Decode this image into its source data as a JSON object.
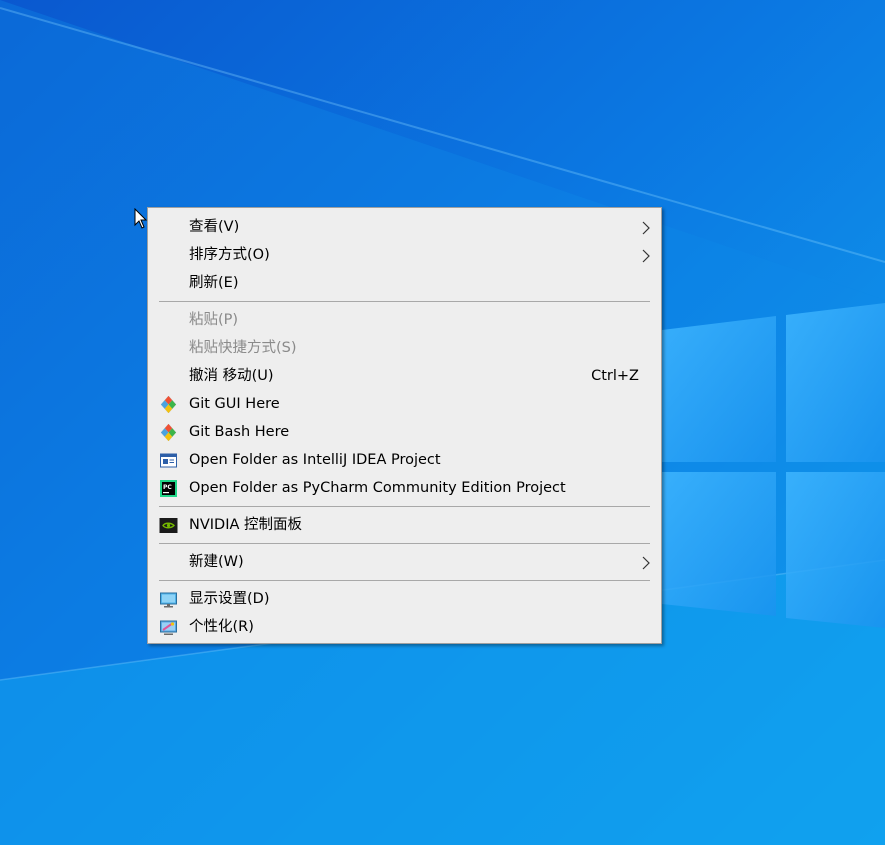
{
  "context_menu": {
    "items": [
      {
        "label": "查看(V)",
        "has_submenu": true
      },
      {
        "label": "排序方式(O)",
        "has_submenu": true
      },
      {
        "label": "刷新(E)"
      },
      {
        "label": "粘贴(P)",
        "disabled": true
      },
      {
        "label": "粘贴快捷方式(S)",
        "disabled": true
      },
      {
        "label": "撤消 移动(U)",
        "shortcut": "Ctrl+Z"
      },
      {
        "label": "Git GUI Here",
        "icon": "git-gui-icon"
      },
      {
        "label": "Git Bash Here",
        "icon": "git-bash-icon"
      },
      {
        "label": "Open Folder as IntelliJ IDEA Project",
        "icon": "intellij-idea-icon"
      },
      {
        "label": "Open Folder as PyCharm Community Edition Project",
        "icon": "pycharm-icon"
      },
      {
        "label": "NVIDIA 控制面板",
        "icon": "nvidia-icon"
      },
      {
        "label": "新建(W)",
        "has_submenu": true
      },
      {
        "label": "显示设置(D)",
        "icon": "display-settings-icon"
      },
      {
        "label": "个性化(R)",
        "icon": "personalize-icon"
      }
    ]
  },
  "colors": {
    "menu_background": "#eeeeee",
    "disabled_text": "#8a8a8a",
    "desktop_blue": "#0b74df"
  }
}
